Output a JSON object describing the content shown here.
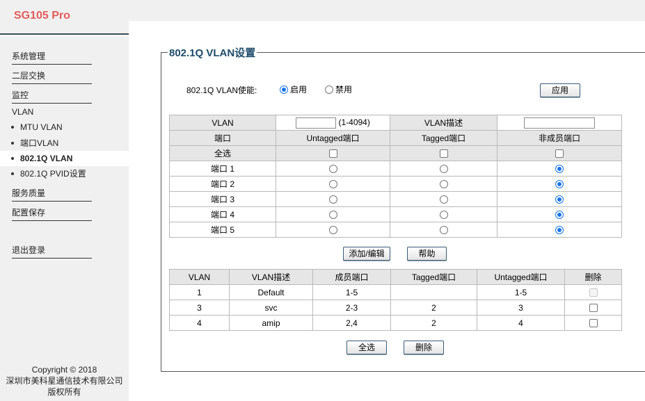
{
  "brand": "SG105 Pro",
  "sidebar": {
    "items": [
      {
        "label": "系统管理"
      },
      {
        "label": "二层交换"
      },
      {
        "label": "监控"
      }
    ],
    "vlan_header": "VLAN",
    "vlan_subitems": [
      {
        "label": "MTU VLAN"
      },
      {
        "label": "端口VLAN"
      },
      {
        "label": "802.1Q VLAN"
      },
      {
        "label": "802.1Q PVID设置"
      }
    ],
    "items2": [
      {
        "label": "服务质量"
      },
      {
        "label": "配置保存"
      }
    ],
    "logout": "退出登录",
    "footer": {
      "line1": "Copyright © 2018",
      "line2": "深圳市美科星通信技术有限公司",
      "line3": "版权所有"
    }
  },
  "panel": {
    "title": "802.1Q VLAN设置",
    "enable": {
      "label": "802.1Q VLAN使能:",
      "on_label": "启用",
      "off_label": "禁用",
      "selected": "on",
      "apply_button": "应用"
    },
    "config": {
      "vlan_label": "VLAN",
      "vlan_value": "",
      "vlan_range": "(1-4094)",
      "desc_label": "VLAN描述",
      "desc_value": "",
      "headers": [
        "端口",
        "Untagged端口",
        "Tagged端口",
        "非成员端口"
      ],
      "select_all_label": "全选",
      "ports": [
        {
          "name": "端口 1",
          "selected": "nonmember"
        },
        {
          "name": "端口 2",
          "selected": "nonmember"
        },
        {
          "name": "端口 3",
          "selected": "nonmember"
        },
        {
          "name": "端口 4",
          "selected": "nonmember"
        },
        {
          "name": "端口 5",
          "selected": "nonmember"
        }
      ],
      "add_button": "添加/编辑",
      "help_button": "帮助"
    },
    "list": {
      "headers": [
        "VLAN",
        "VLAN描述",
        "成员端口",
        "Tagged端口",
        "Untagged端口",
        "删除"
      ],
      "rows": [
        {
          "vlan": "1",
          "desc": "Default",
          "members": "1-5",
          "tagged": "",
          "untagged": "1-5",
          "deletable": false
        },
        {
          "vlan": "3",
          "desc": "svc",
          "members": "2-3",
          "tagged": "2",
          "untagged": "3",
          "deletable": true
        },
        {
          "vlan": "4",
          "desc": "amip",
          "members": "2,4",
          "tagged": "2",
          "untagged": "4",
          "deletable": true
        }
      ],
      "select_all_button": "全选",
      "delete_button": "删除"
    }
  }
}
